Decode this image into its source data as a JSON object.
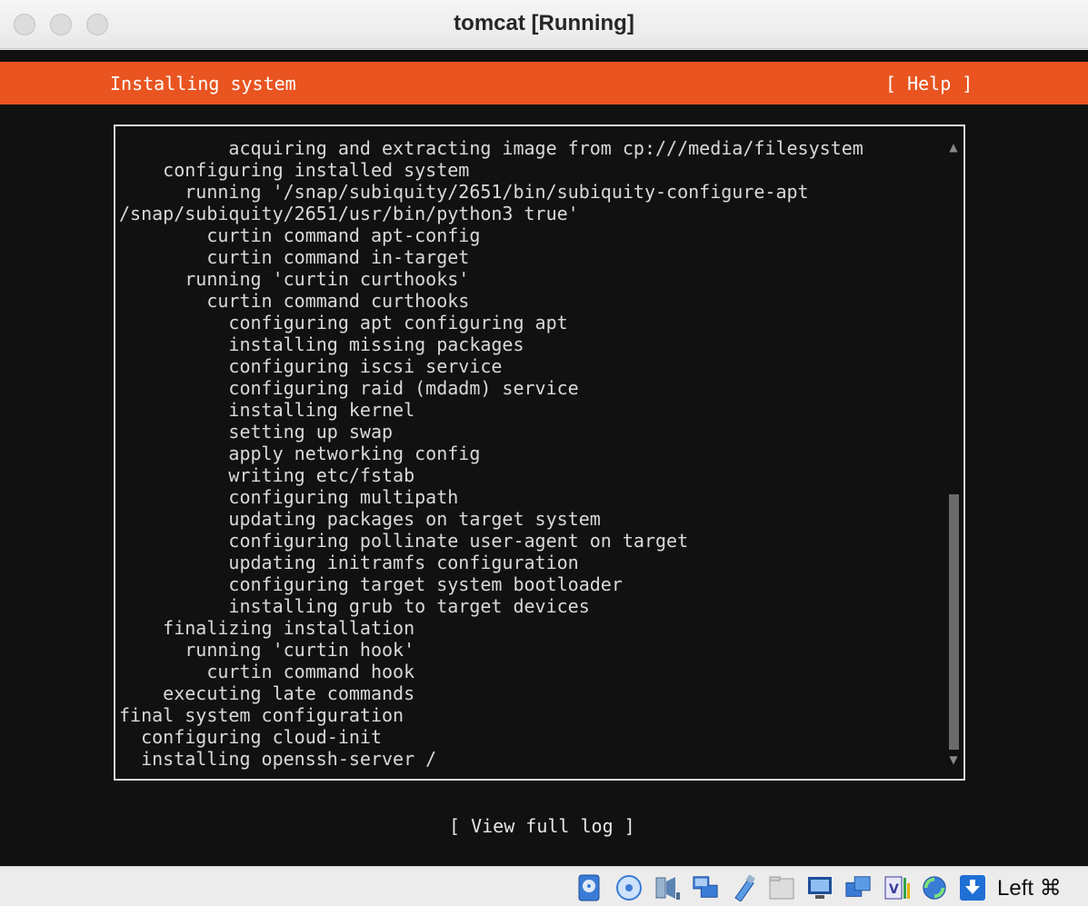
{
  "window": {
    "title": "tomcat [Running]"
  },
  "installer": {
    "header_title": "Installing system",
    "help_label": "[ Help ]",
    "view_log_label": "[ View full log ]",
    "log_lines": [
      "          acquiring and extracting image from cp:///media/filesystem",
      "    configuring installed system",
      "      running '/snap/subiquity/2651/bin/subiquity-configure-apt",
      "/snap/subiquity/2651/usr/bin/python3 true'",
      "        curtin command apt-config",
      "        curtin command in-target",
      "      running 'curtin curthooks'",
      "        curtin command curthooks",
      "          configuring apt configuring apt",
      "          installing missing packages",
      "          configuring iscsi service",
      "          configuring raid (mdadm) service",
      "          installing kernel",
      "          setting up swap",
      "          apply networking config",
      "          writing etc/fstab",
      "          configuring multipath",
      "          updating packages on target system",
      "          configuring pollinate user-agent on target",
      "          updating initramfs configuration",
      "          configuring target system bootloader",
      "          installing grub to target devices",
      "    finalizing installation",
      "      running 'curtin hook'",
      "        curtin command hook",
      "    executing late commands",
      "final system configuration",
      "  configuring cloud-init",
      "  installing openssh-server /"
    ],
    "scrollbar": {
      "thumb_start_fraction": 0.57,
      "thumb_end_fraction": 1.0
    }
  },
  "colors": {
    "accent": "#e95420",
    "terminal_bg": "#111111",
    "terminal_text": "#d9d9d9"
  },
  "statusbar": {
    "icons": [
      "hard-disk-icon",
      "optical-drive-icon",
      "audio-icon",
      "network-icon",
      "usb-icon",
      "shared-folders-icon",
      "display-icon",
      "recording-icon",
      "cpu-vt-x-icon",
      "mouse-integration-icon",
      "keyboard-capture-icon"
    ],
    "host_key": "Left ⌘"
  }
}
